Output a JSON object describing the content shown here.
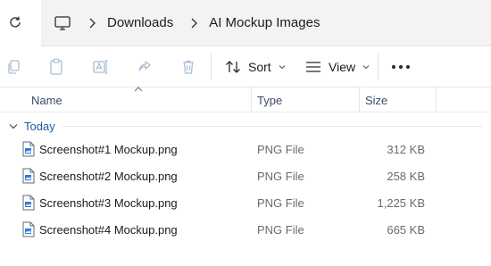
{
  "address_bar": {
    "breadcrumb": [
      "Downloads",
      "AI Mockup Images"
    ],
    "icons": {
      "refresh": "refresh-icon",
      "this_pc": "monitor-icon",
      "separator": "chevron-right-icon"
    }
  },
  "command_bar": {
    "disabled_icons": [
      "copy-icon",
      "paste-icon",
      "rename-icon",
      "share-icon",
      "delete-icon"
    ],
    "sort_label": "Sort",
    "view_label": "View",
    "more": "more-options-icon"
  },
  "columns": {
    "name": "Name",
    "type": "Type",
    "size": "Size",
    "sorted_by": "name"
  },
  "group": {
    "label": "Today",
    "expanded": true
  },
  "files": [
    {
      "name": "Screenshot#1 Mockup.png",
      "type": "PNG File",
      "size": "312 KB"
    },
    {
      "name": "Screenshot#2 Mockup.png",
      "type": "PNG File",
      "size": "258 KB"
    },
    {
      "name": "Screenshot#3 Mockup.png",
      "type": "PNG File",
      "size": "1,225 KB"
    },
    {
      "name": "Screenshot#4 Mockup.png",
      "type": "PNG File",
      "size": "665 KB"
    }
  ],
  "colors": {
    "accent": "#1f5aa8",
    "disabled_icon": "#a9bdd6",
    "header_text": "#3a4a6b",
    "secondary_text": "#6b6b6b"
  }
}
